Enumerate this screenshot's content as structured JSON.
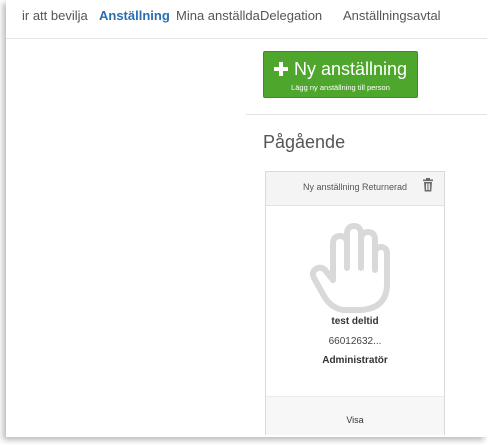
{
  "tabs": [
    {
      "label": "ir att bevilja",
      "active": false
    },
    {
      "label": "Anställning",
      "active": true
    },
    {
      "label": "Mina anställda",
      "active": false
    },
    {
      "label": "Delegation",
      "active": false
    },
    {
      "label": "Anställningsavtal",
      "active": false
    }
  ],
  "new_button": {
    "label": "Ny anställning",
    "sublabel": "Lägg ny anställning till person",
    "icon": "plus-icon",
    "color": "#4ea62c"
  },
  "section": {
    "title": "Pågående"
  },
  "card": {
    "status": "Ny anställning Returnerad",
    "icon": "hand-stop-icon",
    "name": "test deltid",
    "id": "66012632...",
    "role": "Administratör",
    "action": "Visa"
  },
  "colors": {
    "accent": "#2a6db0",
    "button_green": "#4ea62c"
  }
}
